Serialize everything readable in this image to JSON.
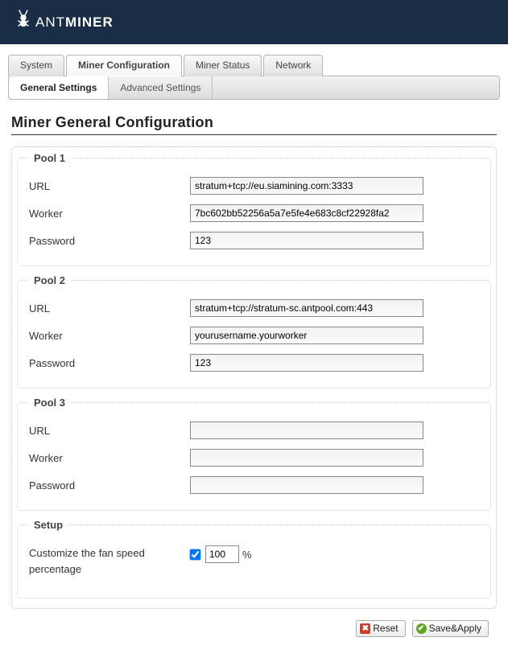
{
  "brand": {
    "prefix": "ANT",
    "suffix": "MINER"
  },
  "tabs": [
    {
      "label": "System",
      "active": false
    },
    {
      "label": "Miner Configuration",
      "active": true
    },
    {
      "label": "Miner Status",
      "active": false
    },
    {
      "label": "Network",
      "active": false
    }
  ],
  "subtabs": [
    {
      "label": "General Settings",
      "active": true
    },
    {
      "label": "Advanced Settings",
      "active": false
    }
  ],
  "page_title": "Miner General Configuration",
  "labels": {
    "url": "URL",
    "worker": "Worker",
    "password": "Password",
    "setup_legend": "Setup",
    "fan_label": "Customize the fan speed percentage",
    "pct_sign": "%"
  },
  "pools": [
    {
      "legend": "Pool 1",
      "url": "stratum+tcp://eu.siamining.com:3333",
      "worker": "7bc602bb52256a5a7e5fe4e683c8cf22928fa2",
      "password": "123"
    },
    {
      "legend": "Pool 2",
      "url": "stratum+tcp://stratum-sc.antpool.com:443",
      "worker": "yourusername.yourworker",
      "password": "123"
    },
    {
      "legend": "Pool 3",
      "url": "",
      "worker": "",
      "password": ""
    }
  ],
  "setup": {
    "fan_checked": true,
    "fan_percent": "100"
  },
  "buttons": {
    "reset": "Reset",
    "save": "Save&Apply"
  }
}
